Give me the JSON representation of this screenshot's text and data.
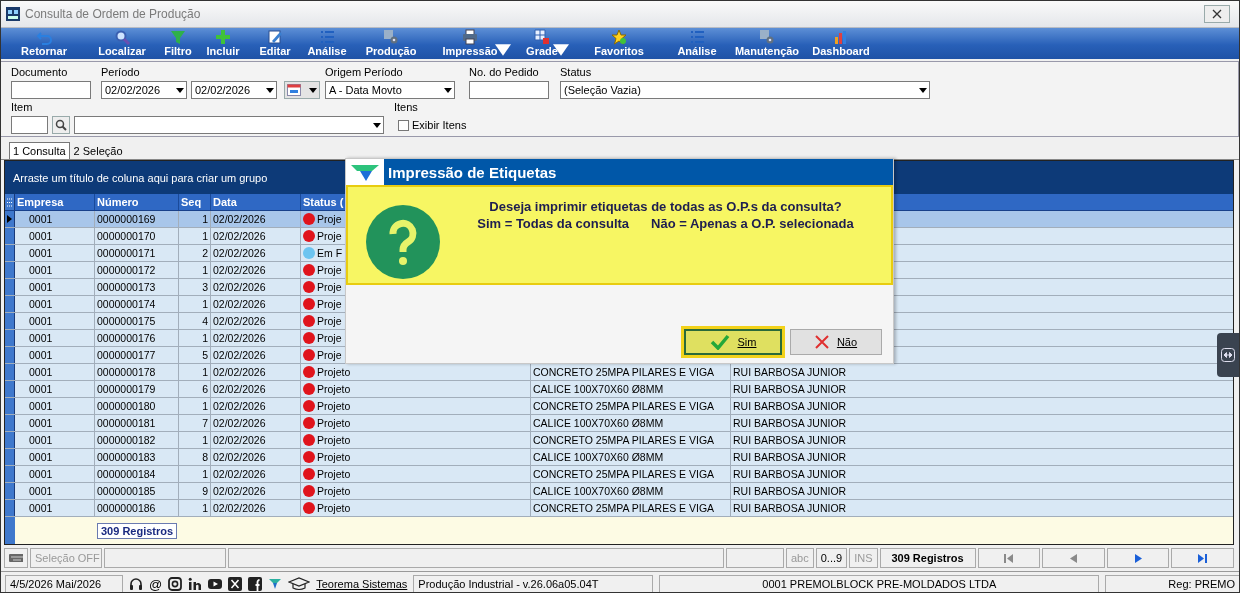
{
  "window": {
    "title": "Consulta de Ordem de Produção"
  },
  "toolbar": [
    {
      "label": "Retornar",
      "dropdown": false
    },
    {
      "label": "Localizar",
      "dropdown": false
    },
    {
      "label": "Filtro",
      "dropdown": false
    },
    {
      "label": "Incluir",
      "dropdown": false
    },
    {
      "label": "Editar",
      "dropdown": false
    },
    {
      "label": "Análise",
      "dropdown": false
    },
    {
      "label": "Produção",
      "dropdown": false
    },
    {
      "label": "Impressão",
      "dropdown": true
    },
    {
      "label": "Grade",
      "dropdown": true
    },
    {
      "label": "Favoritos",
      "dropdown": false
    },
    {
      "label": "Análise",
      "dropdown": false
    },
    {
      "label": "Manutenção",
      "dropdown": false
    },
    {
      "label": "Dashboard",
      "dropdown": false
    }
  ],
  "filters": [
    {
      "label": "Documento",
      "kind": "input"
    },
    {
      "label": "Período",
      "kind": "daterange",
      "values": [
        "02/02/2026",
        "02/02/2026"
      ]
    },
    {
      "kind": "calendar"
    },
    {
      "label": "Origem Período",
      "kind": "combo",
      "value": "A - Data Movto"
    },
    {
      "label": "No. do Pedido",
      "kind": "input"
    },
    {
      "label": "Status",
      "kind": "combo",
      "value": "(Seleção Vazia)"
    }
  ],
  "filters_row2": [
    {
      "label": "Item",
      "kind": "lookup"
    },
    {
      "label": "Itens",
      "kind": "checkbox",
      "text": "Exibir Itens",
      "checked": false
    }
  ],
  "tabs": [
    {
      "label": "1 Consulta",
      "selected": true
    },
    {
      "label": "2 Seleção",
      "selected": false
    }
  ],
  "grid": {
    "group_hint": "Arraste um título de coluna aqui para criar um grupo",
    "columns": [
      "Empresa",
      "Número",
      "Seq",
      "Data",
      "Status ("
    ],
    "rows": [
      {
        "selected": true,
        "cells": [
          "0001",
          "0000000169",
          "1",
          "02/02/2026"
        ],
        "status": {
          "text": "Proje",
          "color": "#e0141c"
        }
      },
      {
        "selected": false,
        "cells": [
          "0001",
          "0000000170",
          "1",
          "02/02/2026"
        ],
        "status": {
          "text": "Proje",
          "color": "#e0141c"
        }
      },
      {
        "selected": false,
        "cells": [
          "0001",
          "0000000171",
          "2",
          "02/02/2026"
        ],
        "status": {
          "text": "Em F",
          "color": "#6cc4f0"
        }
      },
      {
        "selected": false,
        "cells": [
          "0001",
          "0000000172",
          "1",
          "02/02/2026"
        ],
        "status": {
          "text": "Proje",
          "color": "#e0141c"
        }
      },
      {
        "selected": false,
        "cells": [
          "0001",
          "0000000173",
          "3",
          "02/02/2026"
        ],
        "status": {
          "text": "Proje",
          "color": "#e0141c"
        }
      },
      {
        "selected": false,
        "cells": [
          "0001",
          "0000000174",
          "1",
          "02/02/2026"
        ],
        "status": {
          "text": "Proje",
          "color": "#e0141c"
        }
      },
      {
        "selected": false,
        "cells": [
          "0001",
          "0000000175",
          "4",
          "02/02/2026"
        ],
        "status": {
          "text": "Proje",
          "color": "#e0141c"
        }
      },
      {
        "selected": false,
        "cells": [
          "0001",
          "0000000176",
          "1",
          "02/02/2026"
        ],
        "status": {
          "text": "Proje",
          "color": "#e0141c"
        }
      },
      {
        "selected": false,
        "cells": [
          "0001",
          "0000000177",
          "5",
          "02/02/2026"
        ],
        "status": {
          "text": "Proje",
          "color": "#e0141c"
        }
      },
      {
        "selected": false,
        "cells": [
          "0001",
          "0000000178",
          "1",
          "02/02/2026"
        ],
        "status": {
          "text": "Projeto",
          "color": "#e0141c"
        },
        "column_6": "CONCRETO 25MPA PILARES E VIGA",
        "column_7": "RUI BARBOSA JUNIOR"
      },
      {
        "selected": false,
        "cells": [
          "0001",
          "0000000179",
          "6",
          "02/02/2026"
        ],
        "status": {
          "text": "Projeto",
          "color": "#e0141c"
        },
        "column_6": "CALICE 100X70X60 Ø8MM",
        "column_7": "RUI BARBOSA JUNIOR"
      },
      {
        "selected": false,
        "cells": [
          "0001",
          "0000000180",
          "1",
          "02/02/2026"
        ],
        "status": {
          "text": "Projeto",
          "color": "#e0141c"
        },
        "column_6": "CONCRETO 25MPA PILARES E VIGA",
        "column_7": "RUI BARBOSA JUNIOR"
      },
      {
        "selected": false,
        "cells": [
          "0001",
          "0000000181",
          "7",
          "02/02/2026"
        ],
        "status": {
          "text": "Projeto",
          "color": "#e0141c"
        },
        "column_6": "CALICE 100X70X60 Ø8MM",
        "column_7": "RUI BARBOSA JUNIOR"
      },
      {
        "selected": false,
        "cells": [
          "0001",
          "0000000182",
          "1",
          "02/02/2026"
        ],
        "status": {
          "text": "Projeto",
          "color": "#e0141c"
        },
        "column_6": "CONCRETO 25MPA PILARES E VIGA",
        "column_7": "RUI BARBOSA JUNIOR"
      },
      {
        "selected": false,
        "cells": [
          "0001",
          "0000000183",
          "8",
          "02/02/2026"
        ],
        "status": {
          "text": "Projeto",
          "color": "#e0141c"
        },
        "column_6": "CALICE 100X70X60 Ø8MM",
        "column_7": "RUI BARBOSA JUNIOR"
      },
      {
        "selected": false,
        "cells": [
          "0001",
          "0000000184",
          "1",
          "02/02/2026"
        ],
        "status": {
          "text": "Projeto",
          "color": "#e0141c"
        },
        "column_6": "CONCRETO 25MPA PILARES E VIGA",
        "column_7": "RUI BARBOSA JUNIOR"
      },
      {
        "selected": false,
        "cells": [
          "0001",
          "0000000185",
          "9",
          "02/02/2026"
        ],
        "status": {
          "text": "Projeto",
          "color": "#e0141c"
        },
        "column_6": "CALICE 100X70X60 Ø8MM",
        "column_7": "RUI BARBOSA JUNIOR"
      },
      {
        "selected": false,
        "cells": [
          "0001",
          "0000000186",
          "1",
          "02/02/2026"
        ],
        "status": {
          "text": "Projeto",
          "color": "#e0141c"
        },
        "column_6": "CONCRETO 25MPA PILARES E VIGA",
        "column_7": "RUI BARBOSA JUNIOR"
      }
    ],
    "footer_count": "309 Registros"
  },
  "status_bar": {
    "selection": "Seleção OFF",
    "indicators": [
      {
        "text": "abc",
        "on": false
      },
      {
        "text": "0...9",
        "on": true
      },
      {
        "text": "INS",
        "on": false
      }
    ],
    "records": "309 Registros",
    "navigation": [
      {
        "kind": "first",
        "disabled": true
      },
      {
        "kind": "prev",
        "disabled": true
      },
      {
        "kind": "next",
        "disabled": false
      },
      {
        "kind": "last",
        "disabled": false
      }
    ]
  },
  "bottom_bar": {
    "date": "4/5/2026 Mai/2026",
    "email_symbol": "@",
    "link": "Teorema Sistemas",
    "module": "Produção Industrial - v.26.06a05.04T",
    "company": "0001 PREMOLBLOCK PRE-MOLDADOS LTDA",
    "registration": "Reg: PREMO"
  },
  "dialog": {
    "title": "Impressão de Etiquetas",
    "question": "Deseja imprimir etiquetas de todas as O.P.s da consulta?",
    "options": [
      "Sim = Todas da consulta",
      "Não = Apenas a O.P. selecionada"
    ],
    "buttons": [
      {
        "label": "Sim",
        "kind": "yes",
        "focused": true
      },
      {
        "label": "Não",
        "kind": "no",
        "focused": false
      }
    ]
  }
}
